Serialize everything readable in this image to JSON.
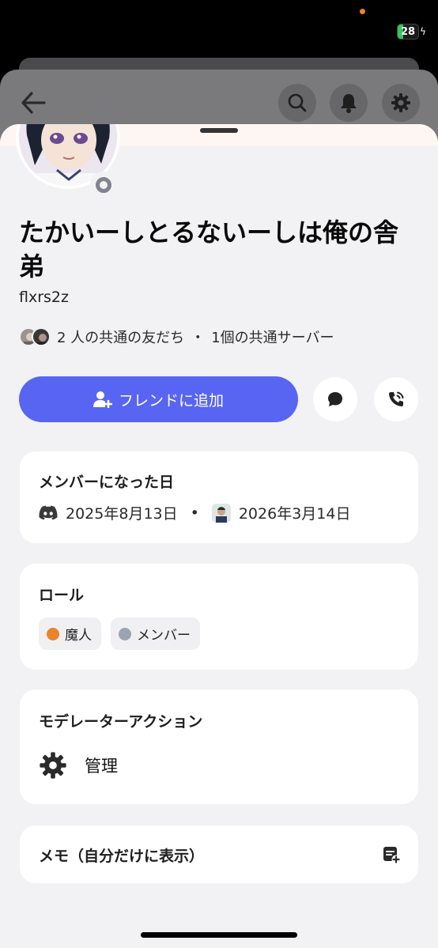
{
  "status_bar": {
    "battery": "28"
  },
  "header": {
    "back_icon": "arrow-left-icon",
    "search_icon": "search-icon",
    "bell_icon": "bell-icon",
    "settings_icon": "gear-icon"
  },
  "profile": {
    "display_name": "たかいーしとるないーしは俺の舎弟",
    "username": "flxrs2z",
    "status": "offline",
    "mutual_friends": "2 人の共通の友だち",
    "mutual_servers": "1個の共通サーバー",
    "separator": "・"
  },
  "actions": {
    "add_friend_label": "フレンドに追加",
    "message_icon": "chat-bubble-icon",
    "call_icon": "phone-call-icon"
  },
  "member_since": {
    "title": "メンバーになった日",
    "discord_date": "2025年8月13日",
    "separator": "•",
    "server_date": "2026年3月14日"
  },
  "roles": {
    "title": "ロール",
    "items": [
      {
        "label": "魔人",
        "color": "#e8842a"
      },
      {
        "label": "メンバー",
        "color": "#9aa5b1"
      }
    ]
  },
  "moderator": {
    "title": "モデレーターアクション",
    "manage_label": "管理"
  },
  "memo": {
    "title": "メモ（自分だけに表示）"
  },
  "colors": {
    "blurple": "#5865f2",
    "battery_green": "#34c759"
  }
}
